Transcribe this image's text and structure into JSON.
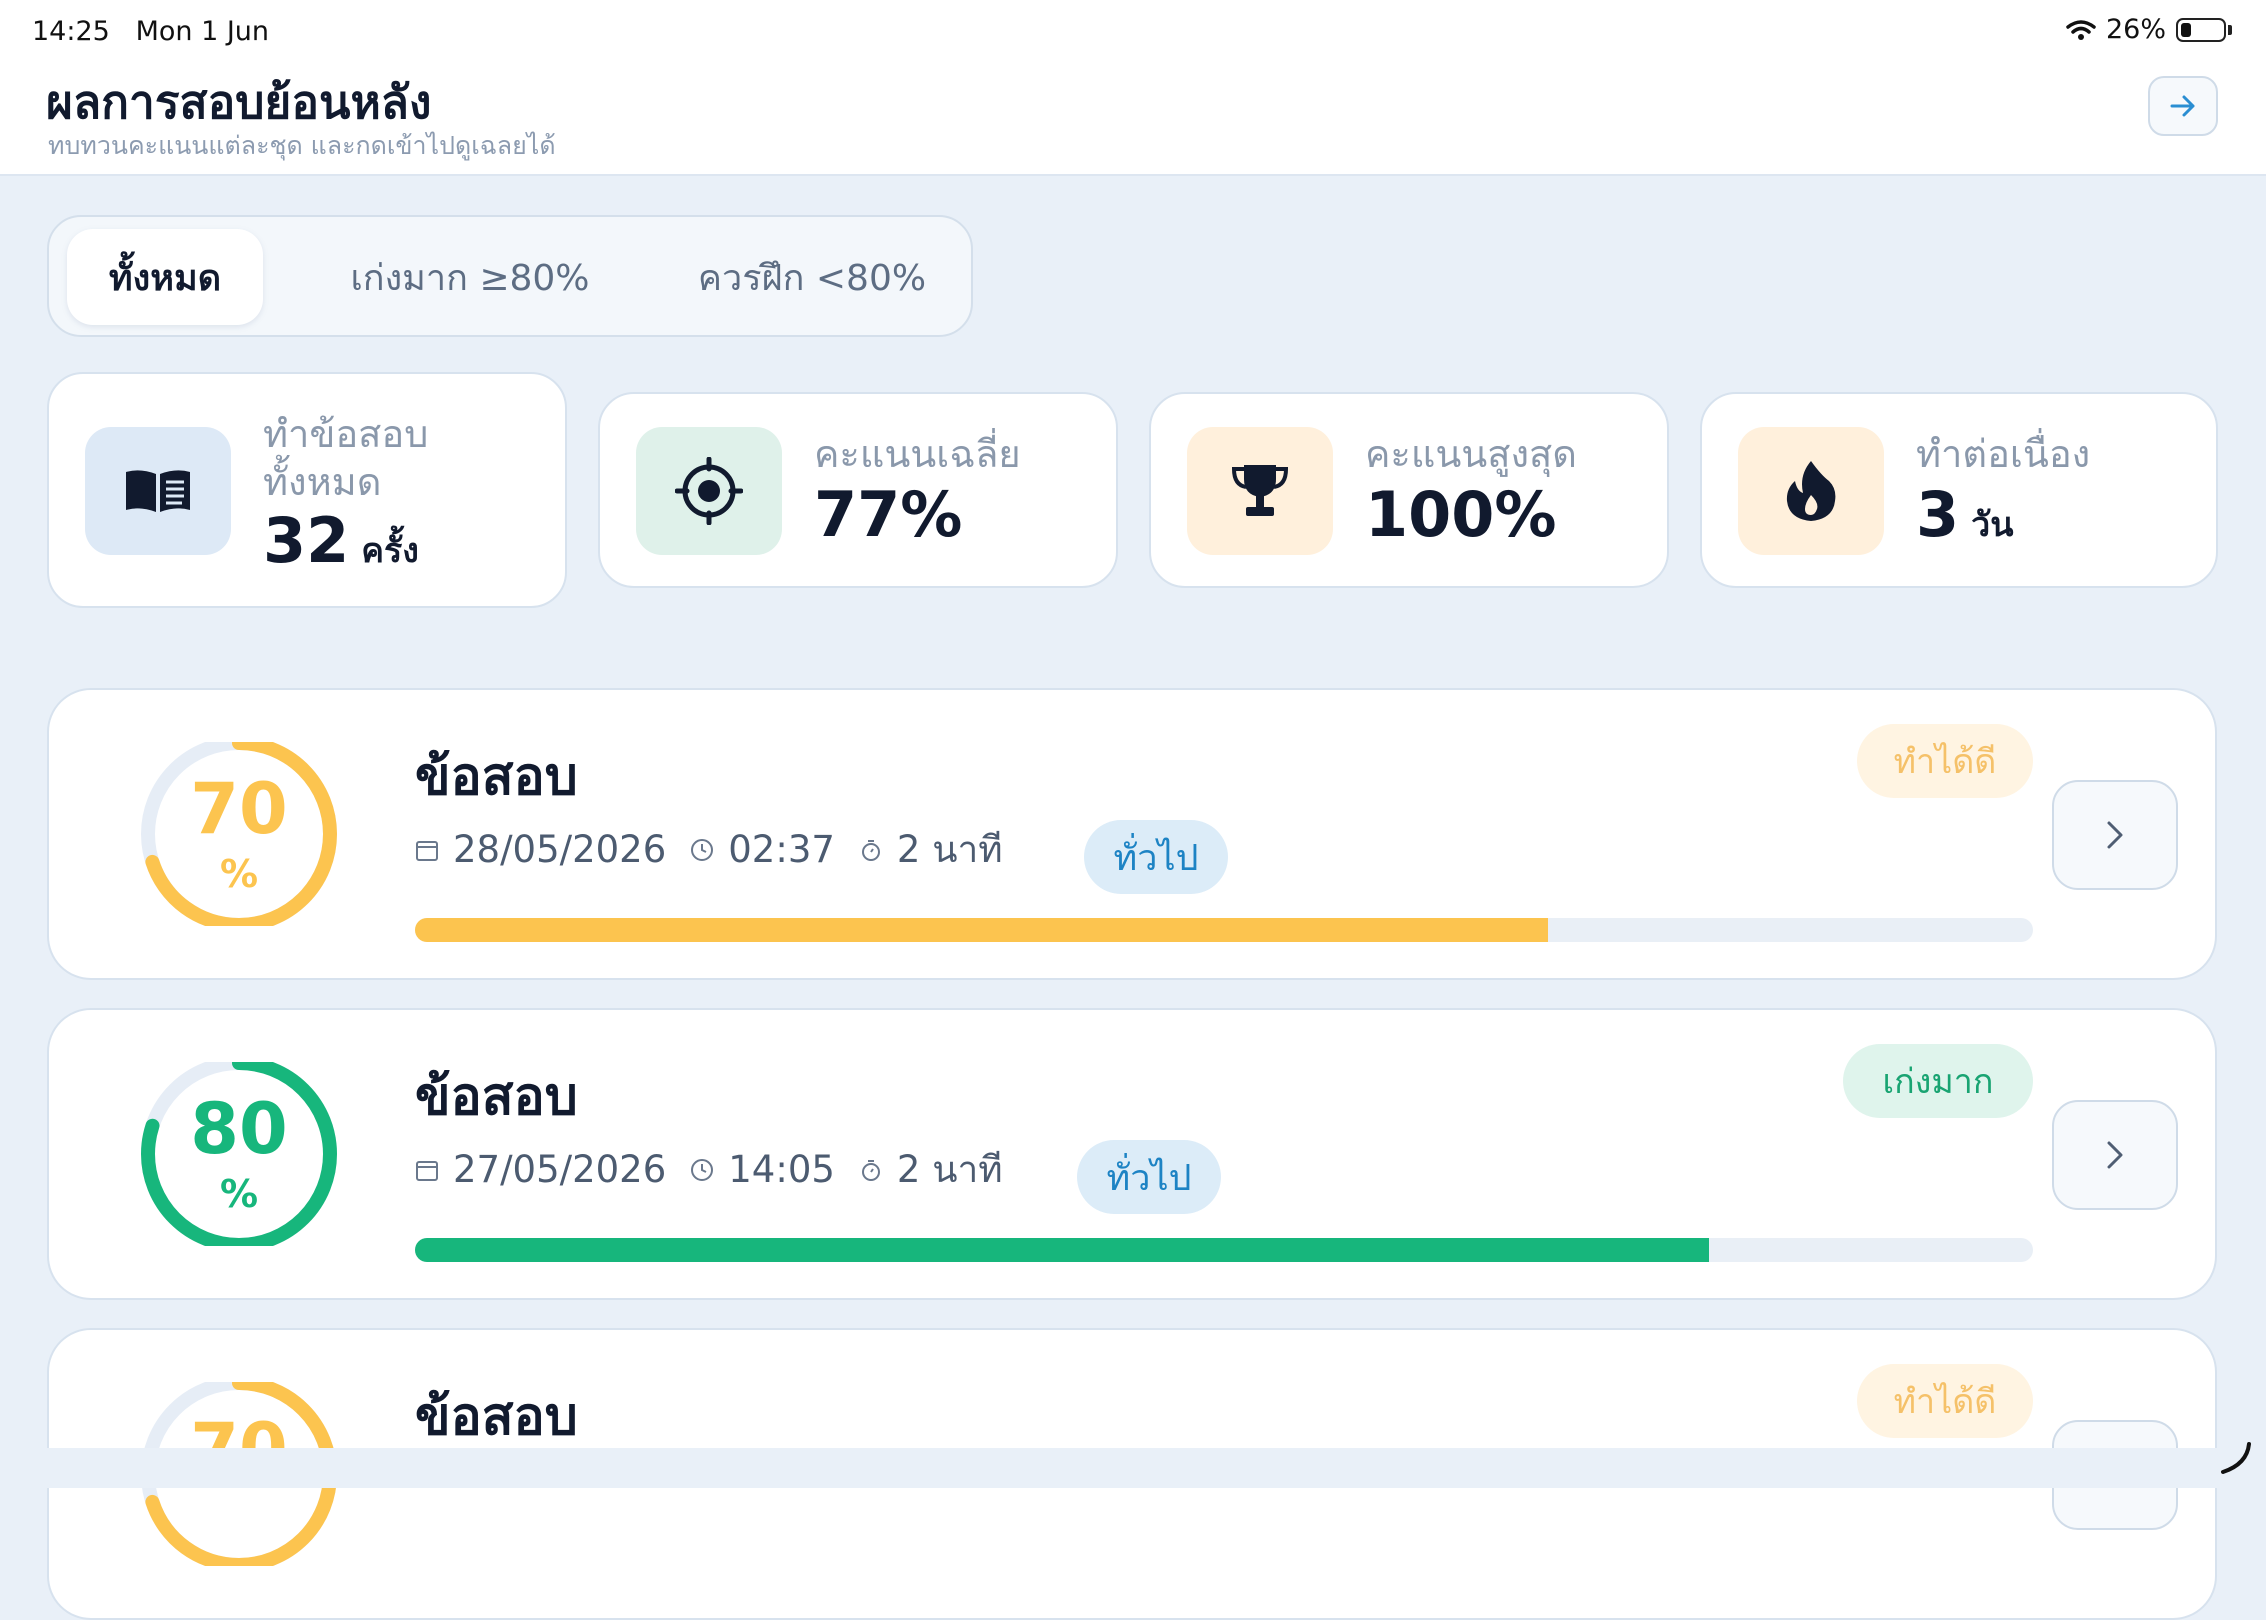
{
  "status_bar": {
    "time": "14:25",
    "date": "Mon 1 Jun",
    "battery": "26%",
    "battery_level": 0.26
  },
  "header": {
    "title": "ผลการสอบย้อนหลัง",
    "subtitle": "ทบทวนคะแนนแต่ละชุด และกดเข้าไปดูเฉลยได้",
    "action_icon": "arrow-right-icon"
  },
  "filters": [
    {
      "label": "ทั้งหมด",
      "active": true
    },
    {
      "label": "เก่งมาก ≥80%",
      "active": false
    },
    {
      "label": "ควรฝึก <80%",
      "active": false
    }
  ],
  "stats": [
    {
      "label_line1": "ทำข้อสอบ",
      "label_line2": "ทั้งหมด",
      "value": "32",
      "unit": "ครั้ง",
      "icon": "book-icon",
      "icon_bg": "#dde9f6"
    },
    {
      "label_line1": "คะแนนเฉลี่ย",
      "value": "77%",
      "icon": "target-icon",
      "icon_bg": "#dff1ea"
    },
    {
      "label_line1": "คะแนนสูงสุด",
      "value": "100%",
      "icon": "trophy-icon",
      "icon_bg": "#fff0dc"
    },
    {
      "label_line1": "ทำต่อเนื่อง",
      "value": "3",
      "unit": "วัน",
      "icon": "flame-icon",
      "icon_bg": "#fff0dc"
    }
  ],
  "exams": [
    {
      "title": "ข้อสอบ",
      "score": "70",
      "score_fraction": 0.7,
      "percent_sign": "%",
      "date": "28/05/2026",
      "time": "02:37",
      "duration": "2 นาที",
      "category": "ทั่วไป",
      "status": "ทำได้ดี",
      "color": "#fcc44f",
      "status_bg": "#fff4e2",
      "status_color": "#f5c169"
    },
    {
      "title": "ข้อสอบ",
      "score": "80",
      "score_fraction": 0.8,
      "percent_sign": "%",
      "date": "27/05/2026",
      "time": "14:05",
      "duration": "2 นาที",
      "category": "ทั่วไป",
      "status": "เก่งมาก",
      "color": "#17b67c",
      "status_bg": "#dff4ec",
      "status_color": "#19a472"
    },
    {
      "title": "ข้อสอบ",
      "score": "70",
      "score_fraction": 0.7,
      "percent_sign": "%",
      "status": "ทำได้ดี",
      "color": "#fcc44f",
      "status_bg": "#fff4e2",
      "status_color": "#f5c169"
    }
  ]
}
